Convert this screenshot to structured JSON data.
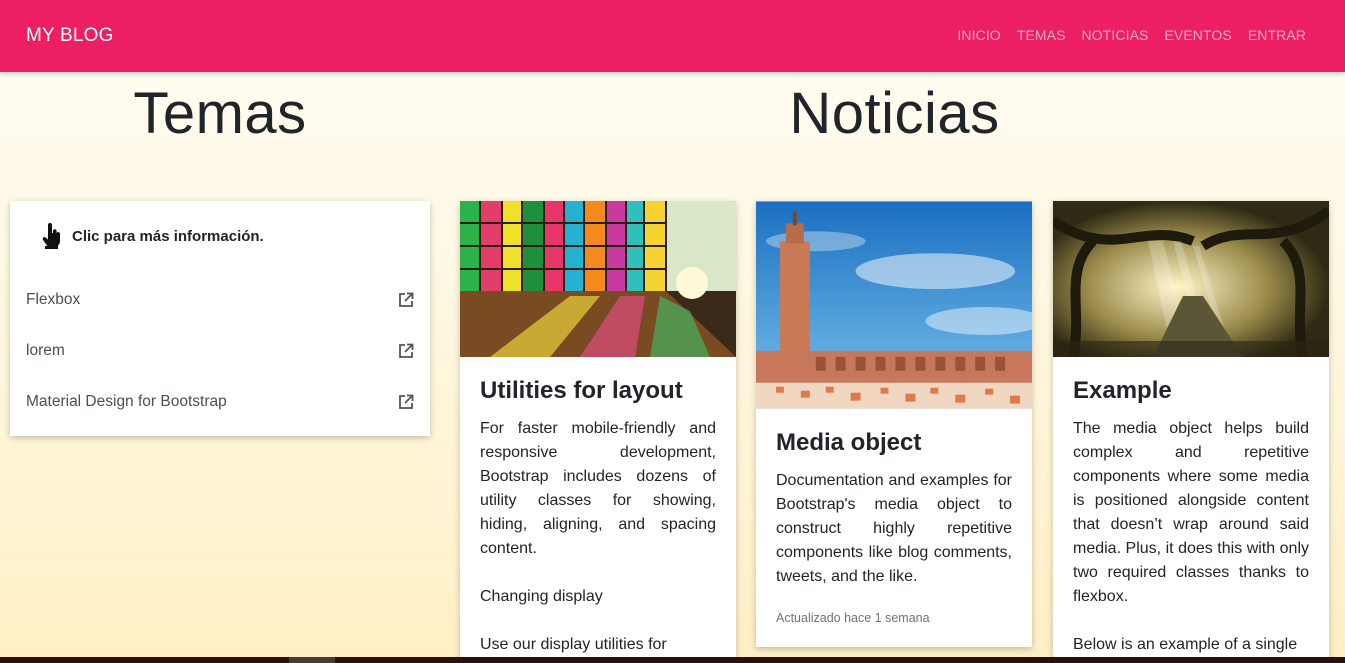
{
  "navbar": {
    "brand": "MY BLOG",
    "links": [
      "INICIO",
      "TEMAS",
      "NOTICIAS",
      "EVENTOS",
      "ENTRAR"
    ],
    "color": "#ec1e64"
  },
  "sections": {
    "temas_title": "Temas",
    "noticias_title": "Noticias"
  },
  "topics": {
    "header": "Clic para más información.",
    "items": [
      {
        "label": "Flexbox",
        "icon": "external-link-icon"
      },
      {
        "label": "lorem",
        "icon": "external-link-icon"
      },
      {
        "label": "Material Design for Bootstrap",
        "icon": "external-link-icon"
      }
    ]
  },
  "cards": [
    {
      "title": "Utilities for layout",
      "image": "stained-glass-building-photo",
      "paragraphs": [
        "For faster mobile-friendly and responsive development, Bootstrap includes dozens of utility classes for showing, hiding, aligning, and spacing content.",
        "Changing display",
        "Use our display utilities for"
      ]
    },
    {
      "title": "Media object",
      "image": "mosque-minaret-photo",
      "paragraphs": [
        "Documentation and examples for Bootstrap's media object to construct highly repetitive components like blog comments, tweets, and the like."
      ],
      "footer": "Actualizado hace 1 semana"
    },
    {
      "title": "Example",
      "image": "forest-road-photo",
      "paragraphs": [
        "The media object helps build complex and repetitive components where some media is positioned alongside content that doesn’t wrap around said media. Plus, it does this with only two required classes thanks to flexbox.",
        "Below is an example of a single"
      ]
    }
  ]
}
